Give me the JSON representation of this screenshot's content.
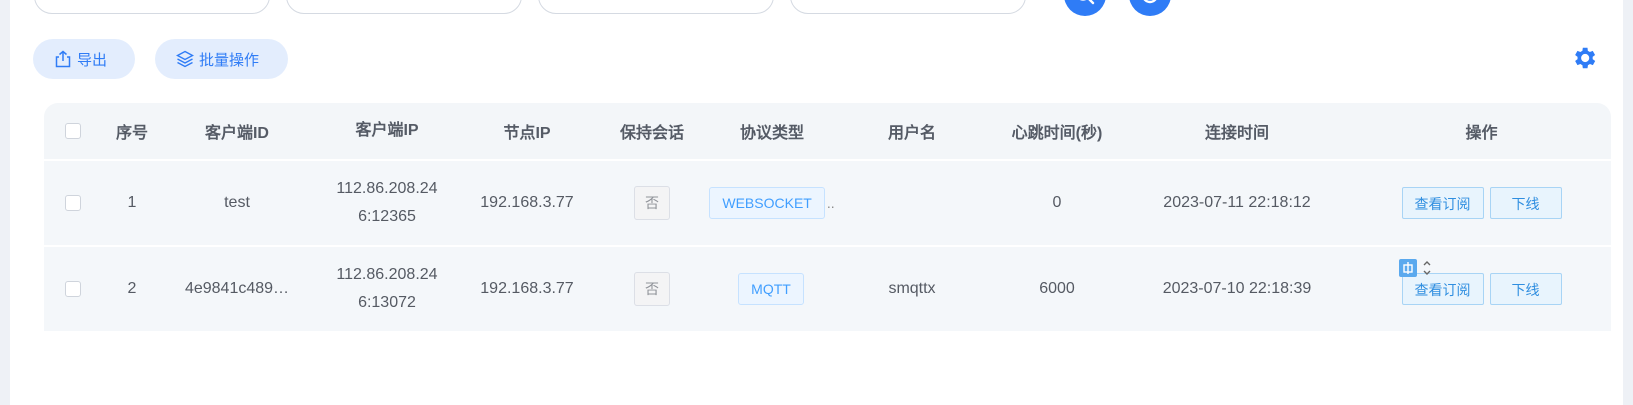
{
  "filters": [
    {
      "placeholder": ""
    },
    {
      "placeholder": ""
    },
    {
      "placeholder": ""
    },
    {
      "placeholder": ""
    }
  ],
  "search_buttons": [
    {
      "icon": "search-icon"
    },
    {
      "icon": "reset-icon"
    }
  ],
  "toolbar": {
    "export_label": "导出",
    "batch_label": "批量操作",
    "settings_icon": "gear-icon",
    "accent": "#2f7cf6"
  },
  "table": {
    "headers": {
      "index": "序号",
      "client_id": "客户端ID",
      "client_ip": "客户端IP",
      "node_ip": "节点IP",
      "keep_session": "保持会话",
      "protocol": "协议类型",
      "username": "用户名",
      "heartbeat": "心跳时间(秒)",
      "connect_time": "连接时间",
      "actions": "操作"
    },
    "rows": [
      {
        "index": "1",
        "client_id": "test",
        "client_ip_line1": "112.86.208.24",
        "client_ip_line2": "6:12365",
        "node_ip": "192.168.3.77",
        "keep_session": "否",
        "protocol": "WEBSOCKET",
        "protocol_more": "..",
        "username": "",
        "heartbeat": "0",
        "connect_time": "2023-07-11 22:18:12",
        "action_view": "查看订阅",
        "action_offline": "下线"
      },
      {
        "index": "2",
        "client_id": "4e9841c489…",
        "client_ip_line1": "112.86.208.24",
        "client_ip_line2": "6:13072",
        "node_ip": "192.168.3.77",
        "keep_session": "否",
        "protocol": "MQTT",
        "protocol_more": "",
        "username": "smqttx",
        "heartbeat": "6000",
        "connect_time": "2023-07-10 22:18:39",
        "action_view": "查看订阅",
        "action_offline": "下线"
      }
    ]
  }
}
